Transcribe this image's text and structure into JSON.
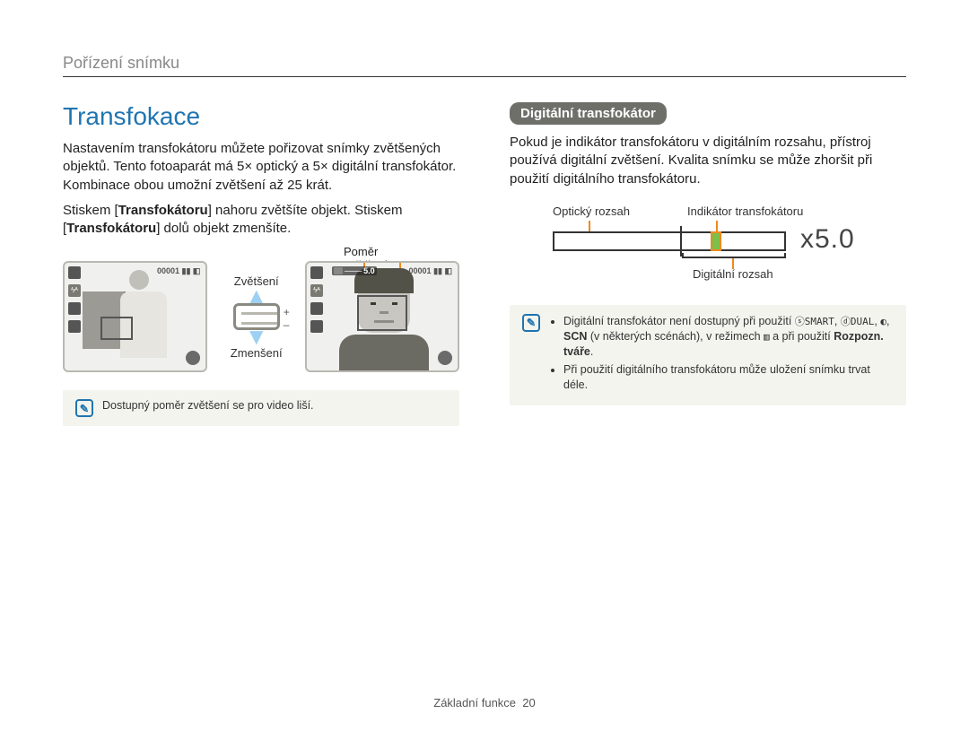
{
  "breadcrumb": "Pořízení snímku",
  "left": {
    "title": "Transfokace",
    "para1": "Nastavením transfokátoru můžete pořizovat snímky zvětšených objektů. Tento fotoaparát má 5× optický a 5× digitální transfokátor. Kombinace obou umožní zvětšení až 25 krát.",
    "para2_pre": "Stiskem [",
    "para2_bold1": "Transfokátoru",
    "para2_mid": "] nahoru zvětšíte objekt. Stiskem [",
    "para2_bold2": "Transfokátoru",
    "para2_post": "] dolů objekt zmenšíte.",
    "ratio_label": "Poměr zvětšení",
    "zoom_in_label": "Zvětšení",
    "zoom_out_label": "Zmenšení",
    "screen_count_a": "00001",
    "screen_count_b": "00001",
    "ratio_value": "5.0",
    "note1": "Dostupný poměr zvětšení se pro video liší."
  },
  "right": {
    "heading": "Digitální transfokátor",
    "para": "Pokud je indikátor transfokátoru v digitálním rozsahu, přístroj používá digitální zvětšení. Kvalita snímku se může zhoršit při použití digitálního transfokátoru.",
    "diagram": {
      "optical_label": "Optický rozsah",
      "indicator_label": "Indikátor transfokátoru",
      "digital_label": "Digitální rozsah",
      "zoom_readout": "x5.0"
    },
    "note2_l1_pre": "Digitální transfokátor není dostupný při použití ",
    "note2_l1_glyph1": "ⓢSMART",
    "note2_l1_glyph2": "ⓓDUAL",
    "note2_l2_pre": ", ",
    "note2_l2_glyph1": "◐",
    "note2_l2_scn": "SCN",
    "note2_l2_mid": " (v některých scénách), v režimech ",
    "note2_l2_glyph2": "▥",
    "note2_l2_post": " a při použití ",
    "note2_l2_bold": "Rozpozn. tváře",
    "note2_l2_end": ".",
    "note2_l3": "Při použití digitálního transfokátoru může uložení snímku trvat déle."
  },
  "footer": {
    "label": "Základní funkce",
    "page": "20"
  }
}
